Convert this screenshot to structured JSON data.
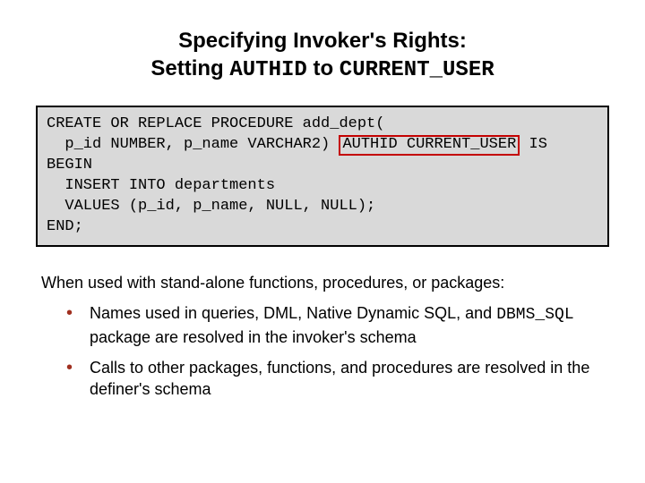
{
  "title": {
    "line1_pre": "Specifying Invoker's Rights:",
    "line2_pre": "Setting ",
    "line2_mono1": "AUTHID",
    "line2_mid": " to ",
    "line2_mono2": "CURRENT_USER"
  },
  "code": {
    "line1": "CREATE OR REPLACE PROCEDURE add_dept(",
    "line2_pre": "  p_id NUMBER, p_name VARCHAR2) ",
    "line2_hl": "AUTHID CURRENT_USER",
    "line2_post": " IS",
    "line3": "BEGIN",
    "line4": "  INSERT INTO departments",
    "line5": "  VALUES (p_id, p_name, NULL, NULL);",
    "line6": "END;"
  },
  "intro": "When used with stand-alone functions, procedures, or packages:",
  "bullets": {
    "b1_pre": "Names used in queries, DML, Native Dynamic SQL, and ",
    "b1_mono": "DBMS_SQL",
    "b1_post": " package are resolved in the invoker's schema",
    "b2": "Calls to other packages, functions, and procedures are resolved in the definer's schema"
  }
}
